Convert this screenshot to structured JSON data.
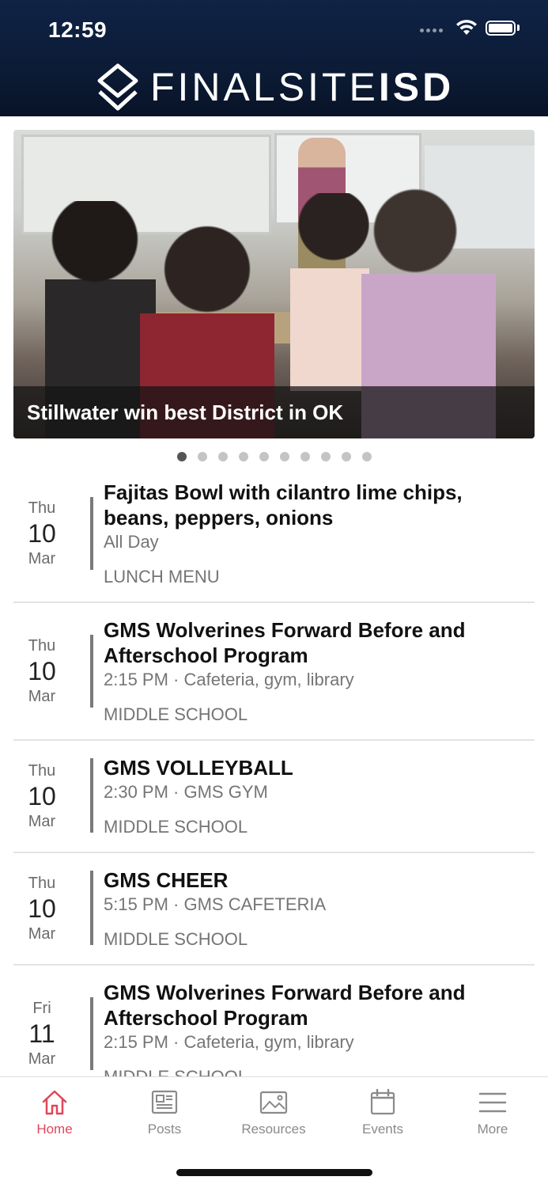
{
  "status": {
    "time": "12:59"
  },
  "header": {
    "brand_light": "FINALSITE",
    "brand_bold": "ISD"
  },
  "hero": {
    "caption": "Stillwater win best District in OK",
    "dots": 10,
    "active_dot": 0
  },
  "events": [
    {
      "dow": "Thu",
      "day": "10",
      "mon": "Mar",
      "title": "Fajitas Bowl with cilantro lime chips, beans, peppers, onions",
      "time": "All Day",
      "category": "LUNCH MENU"
    },
    {
      "dow": "Thu",
      "day": "10",
      "mon": "Mar",
      "title": "GMS Wolverines Forward Before and Afterschool Program",
      "time": "2:15 PM · Cafeteria, gym,  library",
      "category": "MIDDLE SCHOOL"
    },
    {
      "dow": "Thu",
      "day": "10",
      "mon": "Mar",
      "title": "GMS VOLLEYBALL",
      "time": "2:30 PM · GMS GYM",
      "category": "MIDDLE SCHOOL"
    },
    {
      "dow": "Thu",
      "day": "10",
      "mon": "Mar",
      "title": "GMS CHEER",
      "time": "5:15 PM · GMS CAFETERIA",
      "category": "MIDDLE SCHOOL"
    },
    {
      "dow": "Fri",
      "day": "11",
      "mon": "Mar",
      "title": "GMS Wolverines Forward Before and Afterschool Program",
      "time": "2:15 PM · Cafeteria, gym,  library",
      "category": "MIDDLE SCHOOL"
    }
  ],
  "tabs": [
    {
      "label": "Home",
      "icon": "home-icon",
      "active": true
    },
    {
      "label": "Posts",
      "icon": "newspaper-icon",
      "active": false
    },
    {
      "label": "Resources",
      "icon": "image-icon",
      "active": false
    },
    {
      "label": "Events",
      "icon": "calendar-icon",
      "active": false
    },
    {
      "label": "More",
      "icon": "menu-icon",
      "active": false
    }
  ],
  "colors": {
    "accent": "#e0465a",
    "header_bg": "#0c1b36"
  }
}
